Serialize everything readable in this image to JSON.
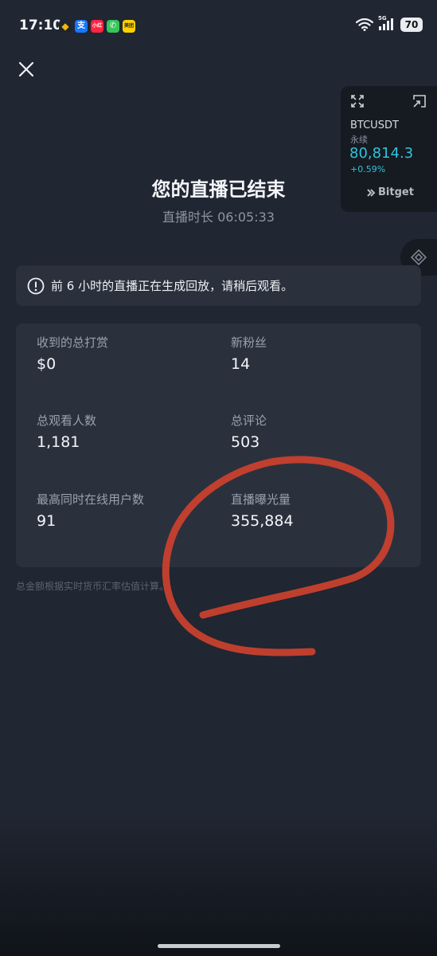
{
  "status_bar": {
    "time": "17:10",
    "notifications": [
      {
        "icon": "binance-icon",
        "label": "◆"
      },
      {
        "icon": "alipay-icon",
        "label": "支"
      },
      {
        "icon": "xiaohongshu-icon",
        "label": "小红书"
      },
      {
        "icon": "phone-icon",
        "label": "✆"
      },
      {
        "icon": "meituan-icon",
        "label": "美团"
      }
    ],
    "network": "5G",
    "battery": "70"
  },
  "ticker": {
    "symbol": "BTCUSDT",
    "type": "永续",
    "price": "80,814.3",
    "change": "+0.59%",
    "brand": "Bitget",
    "accent_color": "#2fc3dc"
  },
  "header": {
    "title": "您的直播已结束",
    "duration": "直播时长 06:05:33"
  },
  "notice": {
    "text": "前 6 小时的直播正在生成回放，请稍后观看。"
  },
  "stats": [
    {
      "label": "收到的总打赏",
      "value": "$0"
    },
    {
      "label": "新粉丝",
      "value": "14"
    },
    {
      "label": "总观看人数",
      "value": "1,181"
    },
    {
      "label": "总评论",
      "value": "503"
    },
    {
      "label": "最高同时在线用户数",
      "value": "91"
    },
    {
      "label": "直播曝光量",
      "value": "355,884"
    }
  ],
  "footnote": "总金额根据实时货币汇率估值计算。",
  "annotation_color": "#c8402e"
}
